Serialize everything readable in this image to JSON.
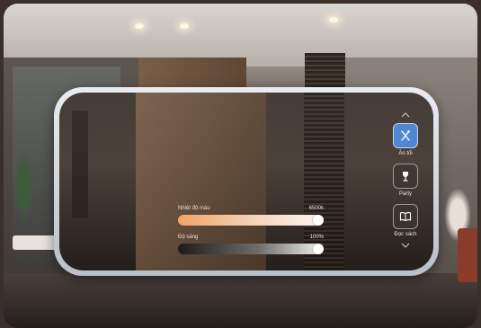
{
  "controls": {
    "color_temperature": {
      "label": "Nhiệt độ màu",
      "value_text": "6500k",
      "level": 1.0
    },
    "brightness": {
      "label": "Độ sáng",
      "value_text": "100%",
      "level": 1.0
    }
  },
  "scenes": {
    "items": [
      {
        "label": "Ăn tối",
        "icon": "utensils-icon",
        "active": true
      },
      {
        "label": "Party",
        "icon": "wine-glass-icon",
        "active": false
      },
      {
        "label": "Đọc sách",
        "icon": "book-icon",
        "active": false
      }
    ]
  },
  "colors": {
    "active_scene": "#4f87d4",
    "temperature_start": "#f1a466",
    "temperature_end": "#fdf6f1"
  }
}
